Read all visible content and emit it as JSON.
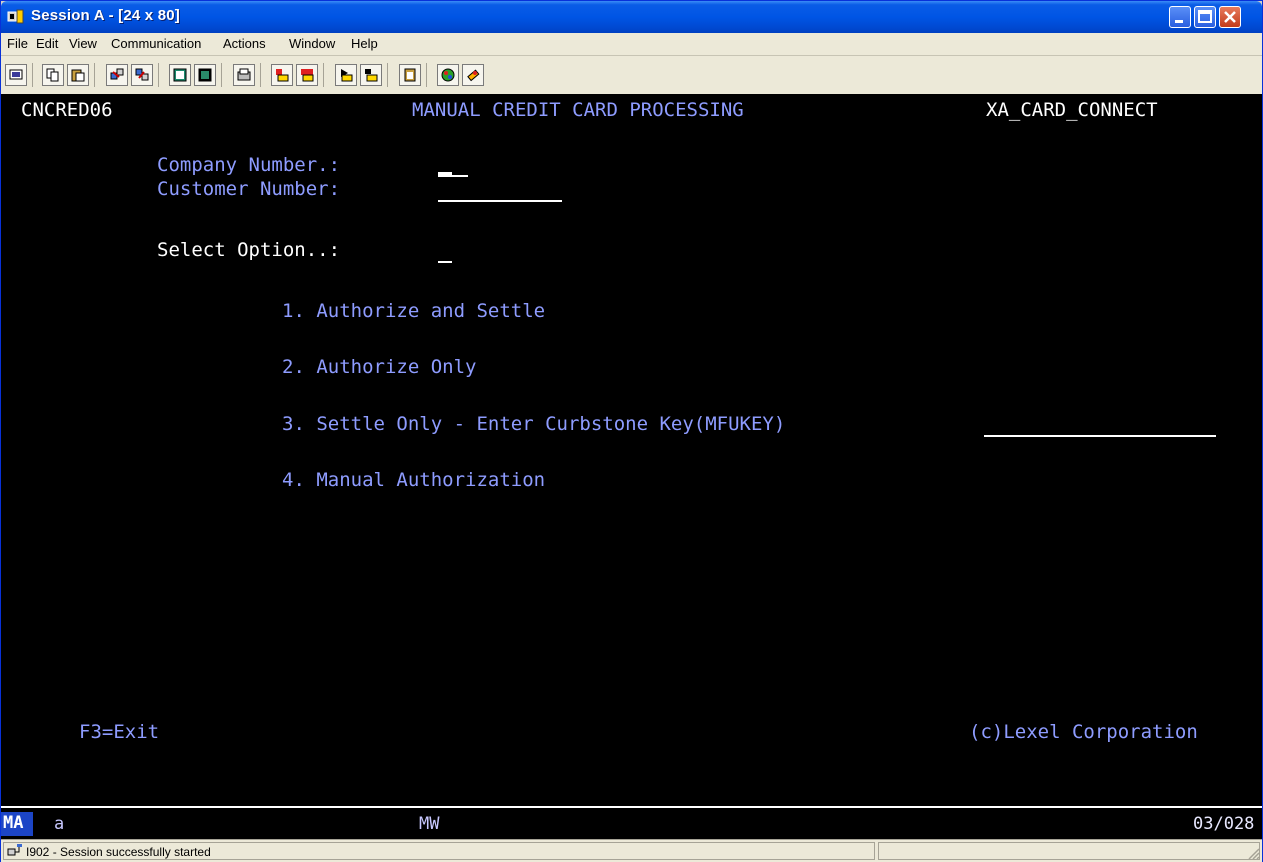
{
  "window": {
    "title": "Session A - [24 x 80]"
  },
  "menu": {
    "items": [
      "File",
      "Edit",
      "View",
      "Communication",
      "Actions",
      "Window",
      "Help"
    ]
  },
  "toolbar": {
    "buttons": [
      "print-screen",
      "copy",
      "paste",
      "send",
      "receive",
      "display-macro",
      "record-macro",
      "keyboard-map",
      "start-record",
      "stop-record",
      "play-macro",
      "macro-stop",
      "clipboard",
      "color-palette",
      "map"
    ]
  },
  "screen": {
    "program_id": "CNCRED06",
    "heading": "MANUAL CREDIT CARD PROCESSING",
    "system_name": "XA_CARD_CONNECT",
    "company_label": "Company Number.:",
    "customer_label": "Customer Number:",
    "select_label": "Select Option..:",
    "option1": "1. Authorize and Settle",
    "option2": "2. Authorize Only",
    "option3": "3. Settle Only - Enter Curbstone Key(MFUKEY)",
    "option4": "4. Manual Authorization",
    "f3": "F3=Exit",
    "copyright": "(c)Lexel Corporation"
  },
  "oia": {
    "mode": "MA",
    "indicator": "a",
    "mw": "MW",
    "cursor_pos": "03/028"
  },
  "status": {
    "message": "I902 - Session successfully started"
  },
  "colors": {
    "terminal_bg": "#000000",
    "field_text": "#8e9cff",
    "bright_text": "#ffffff",
    "title_blue": "#0055e5"
  }
}
